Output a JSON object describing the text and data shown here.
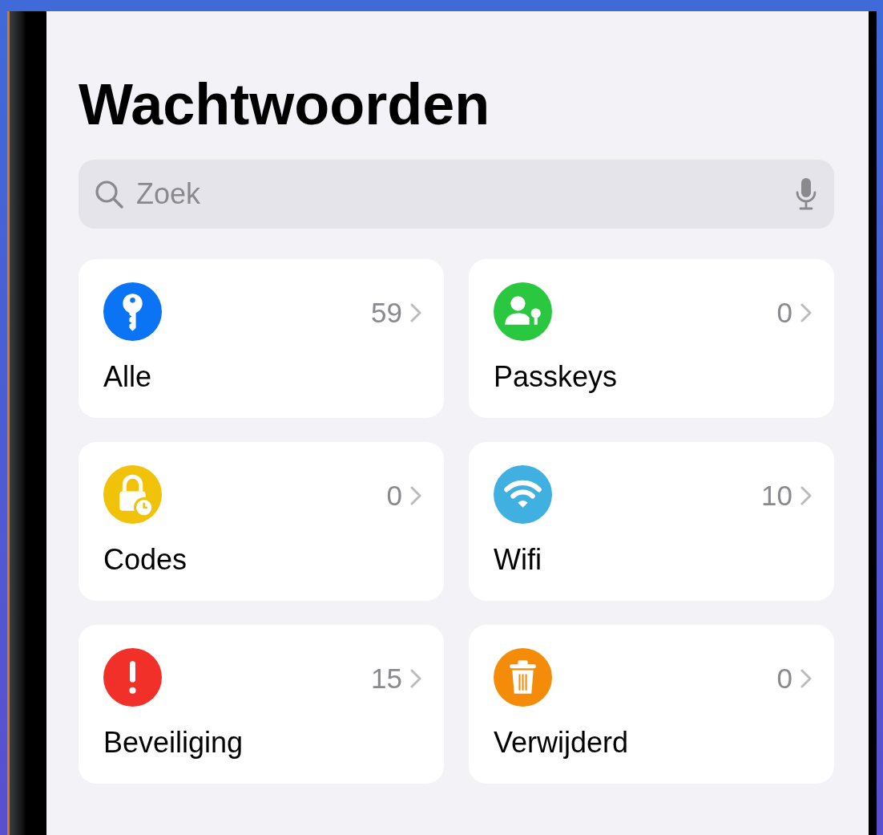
{
  "title": "Wachtwoorden",
  "search": {
    "placeholder": "Zoek"
  },
  "categories": [
    {
      "label": "Alle",
      "count": "59",
      "kind": "key",
      "color": "#0a74f5"
    },
    {
      "label": "Passkeys",
      "count": "0",
      "kind": "passkey",
      "color": "#2ac840"
    },
    {
      "label": "Codes",
      "count": "0",
      "kind": "code",
      "color": "#f0c20a"
    },
    {
      "label": "Wifi",
      "count": "10",
      "kind": "wifi",
      "color": "#3fb0e0"
    },
    {
      "label": "Beveiliging",
      "count": "15",
      "kind": "alert",
      "color": "#f2302a"
    },
    {
      "label": "Verwijderd",
      "count": "0",
      "kind": "trash",
      "color": "#f48c0a"
    }
  ]
}
